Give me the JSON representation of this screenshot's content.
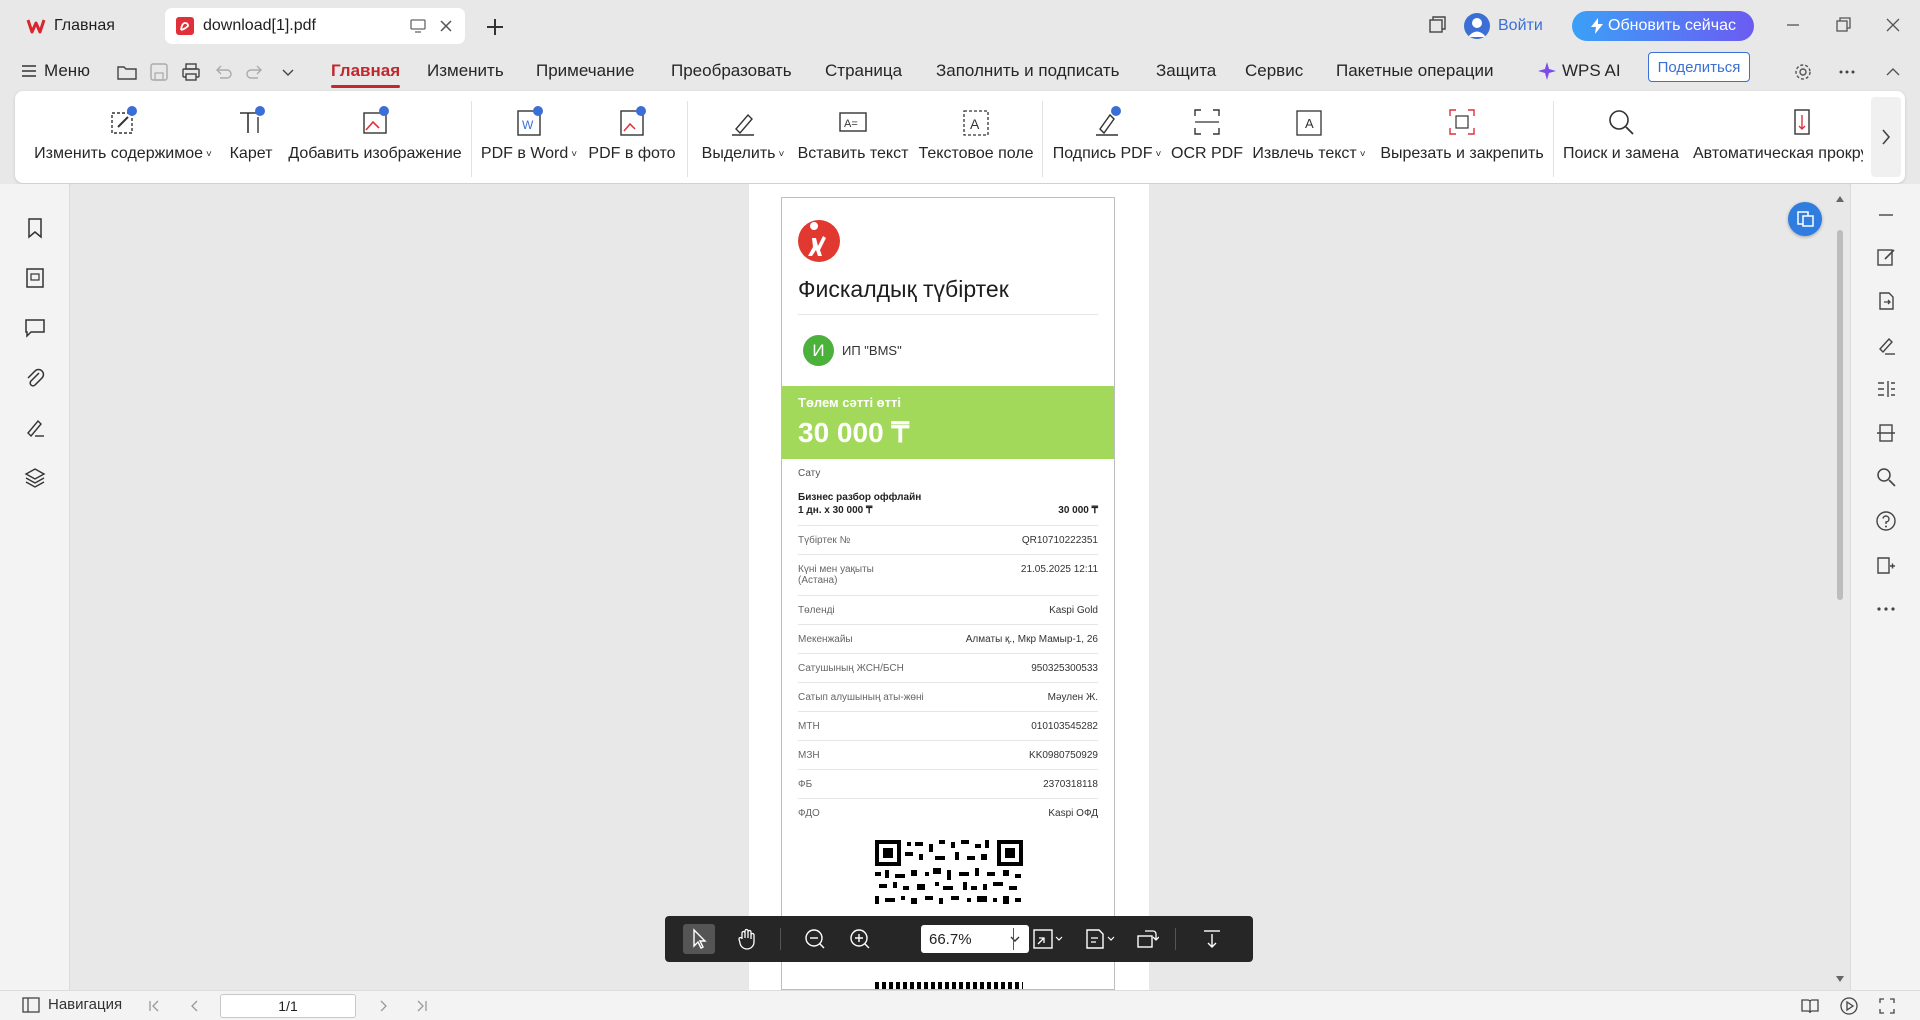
{
  "tabs": {
    "home_label": "Главная",
    "doc_label": "download[1].pdf"
  },
  "header": {
    "login_label": "Войти",
    "update_label": "Обновить сейчас"
  },
  "menu": {
    "menu_label": "Меню",
    "items": [
      "Главная",
      "Изменить",
      "Примечание",
      "Преобразовать",
      "Страница",
      "Заполнить и подписать",
      "Защита",
      "Сервис",
      "Пакетные операции"
    ],
    "active": "Главная",
    "wps_ai_label": "WPS AI",
    "share_label": "Поделиться"
  },
  "ribbon": {
    "edit_content": "Изменить содержимое",
    "caret": "Карет",
    "add_image": "Добавить изображение",
    "pdf_to_word": "PDF в Word",
    "pdf_to_photo": "PDF в фото",
    "highlight": "Выделить",
    "insert_text": "Вставить текст",
    "text_field": "Текстовое поле",
    "sign_pdf": "Подпись PDF",
    "ocr_pdf": "OCR PDF",
    "extract_text": "Извлечь текст",
    "cut_pin": "Вырезать и закрепить",
    "find_replace": "Поиск и замена",
    "auto_scroll": "Автоматическая прокрут"
  },
  "receipt": {
    "title": "Фискалдық түбіртек",
    "merchant_initial": "И",
    "merchant": "ИП \"BMS\"",
    "status": "Төлем сәтті өтті",
    "amount": "30 000 ₸",
    "sale_label": "Сату",
    "item_name": "Бизнес разбор оффлайн",
    "item_qty": "1 дн. x 30 000 ₸",
    "item_total": "30 000 ₸",
    "rows": [
      {
        "label": "Түбіртек №",
        "value": "QR10710222351"
      },
      {
        "label": "Күні мен уақыты",
        "label2": "(Астана)",
        "value": "21.05.2025 12:11"
      },
      {
        "label": "Төленді",
        "value": "Kaspi Gold"
      },
      {
        "label": "Мекенжайы",
        "value": "Алматы қ., Мкр Мамыр-1, 26"
      },
      {
        "label": "Сатушының ЖСН/БСН",
        "value": "950325300533"
      },
      {
        "label": "Сатып алушының аты-жөні",
        "value": "Мәулен Ж."
      },
      {
        "label": "МТН",
        "value": "010103545282"
      },
      {
        "label": "МЗН",
        "value": "KK0980750929"
      },
      {
        "label": "ФБ",
        "value": "2370318118"
      },
      {
        "label": "ФДО",
        "value": "Kaspi ОФД"
      }
    ]
  },
  "toolbar": {
    "zoom": "66.7%"
  },
  "statusbar": {
    "navigation_label": "Навигация",
    "page_indicator": "1/1"
  },
  "colors": {
    "accent": "#c1272d",
    "receipt_green": "#a3d95a",
    "kaspi_red": "#e1392f",
    "link_blue": "#3b6fd6"
  }
}
